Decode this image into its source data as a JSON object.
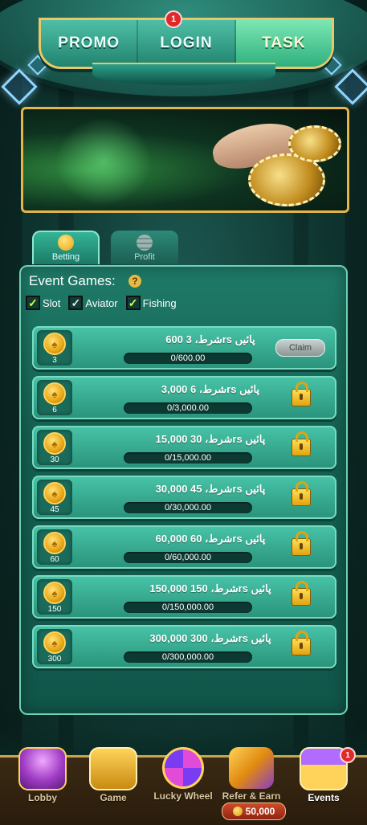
{
  "top_tabs": {
    "items": [
      {
        "label": "PROMO"
      },
      {
        "label": "LOGIN"
      },
      {
        "label": "TASK"
      }
    ],
    "active": "TASK",
    "login_badge": "1"
  },
  "sub_tabs": {
    "betting": "Betting",
    "profit": "Profit"
  },
  "panel": {
    "title": "Event Games:",
    "help_glyph": "?",
    "filters": [
      {
        "label": "Slot",
        "checked": true
      },
      {
        "label": "Aviator",
        "checked": true
      },
      {
        "label": "Fishing",
        "checked": true
      }
    ],
    "check_glyph": "✓",
    "claim_label": "Claim",
    "tasks": [
      {
        "coin": "3",
        "title": "600 شرط، 3rs پائیں",
        "progress": "0/600.00",
        "state": "claim"
      },
      {
        "coin": "6",
        "title": "3,000 شرط، 6rs پائیں",
        "progress": "0/3,000.00",
        "state": "locked"
      },
      {
        "coin": "30",
        "title": "15,000 شرط، 30rs پائیں",
        "progress": "0/15,000.00",
        "state": "locked"
      },
      {
        "coin": "45",
        "title": "30,000 شرط، 45rs پائیں",
        "progress": "0/30,000.00",
        "state": "locked"
      },
      {
        "coin": "60",
        "title": "60,000 شرط، 60rs پائیں",
        "progress": "0/60,000.00",
        "state": "locked"
      },
      {
        "coin": "150",
        "title": "150,000 شرط، 150rs پائیں",
        "progress": "0/150,000.00",
        "state": "locked"
      },
      {
        "coin": "300",
        "title": "300,000 شرط، 300rs پائیں",
        "progress": "0/300,000.00",
        "state": "locked"
      }
    ]
  },
  "bottom_nav": {
    "items": [
      {
        "label": "Lobby",
        "icon": "casino-building-icon"
      },
      {
        "label": "Game",
        "icon": "slot-machine-icon"
      },
      {
        "label": "Lucky Wheel",
        "icon": "lucky-wheel-icon"
      },
      {
        "label": "Refer & Earn",
        "icon": "refer-earn-icon"
      },
      {
        "label": "Events",
        "icon": "gift-box-icon"
      }
    ],
    "active": "Events",
    "events_badge": "1",
    "balance": "50,000"
  },
  "colors": {
    "accent_gold": "#e6b54a",
    "panel_green": "#1f7a68",
    "badge_red": "#e02a2a"
  }
}
